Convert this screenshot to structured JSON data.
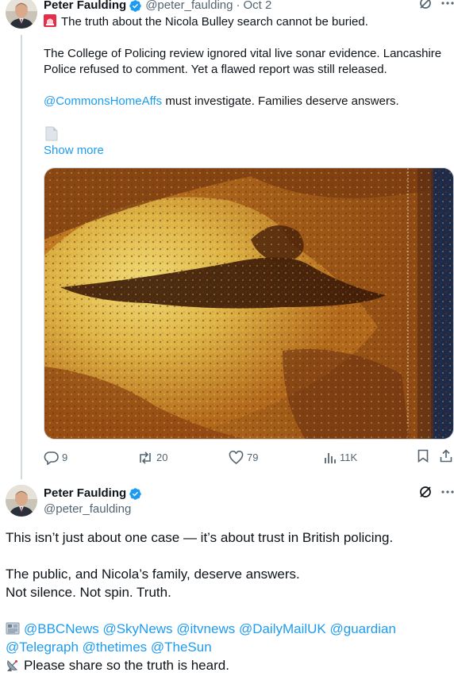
{
  "tweet1": {
    "author_name": "Peter Faulding",
    "handle": "@peter_faulding",
    "separator": "·",
    "date": "Oct 2",
    "line1": "The truth about the Nicola Bulley search cannot be buried.",
    "line2a": "The College of Policing review ignored vital live sonar evidence. Lancashire",
    "line2b": "Police refused to comment. Yet a flawed report was still released.",
    "mention": "@CommonsHomeAffs",
    "line3_rest": " must investigate. Families deserve answers.",
    "show_more": "Show more",
    "stats": {
      "replies": "9",
      "reposts": "20",
      "likes": "79",
      "views": "11K"
    }
  },
  "tweet2": {
    "author_name": "Peter Faulding",
    "handle": "@peter_faulding",
    "p1": "This isn’t just about one case — it’s about trust in British policing.",
    "p2a": "The public, and Nicola’s family, deserve answers.",
    "p2b": "Not silence. Not spin. Truth.",
    "mentions_line1": "@BBCNews @SkyNews @itvnews @DailyMailUK @guardian",
    "mentions_line2": "@Telegraph @thetimes @TheSun",
    "share": "Please share so the truth is heard."
  },
  "colors": {
    "link": "#1d9bf0",
    "muted": "#536471",
    "verified": "#1d9bf0",
    "text": "#0f1419"
  }
}
